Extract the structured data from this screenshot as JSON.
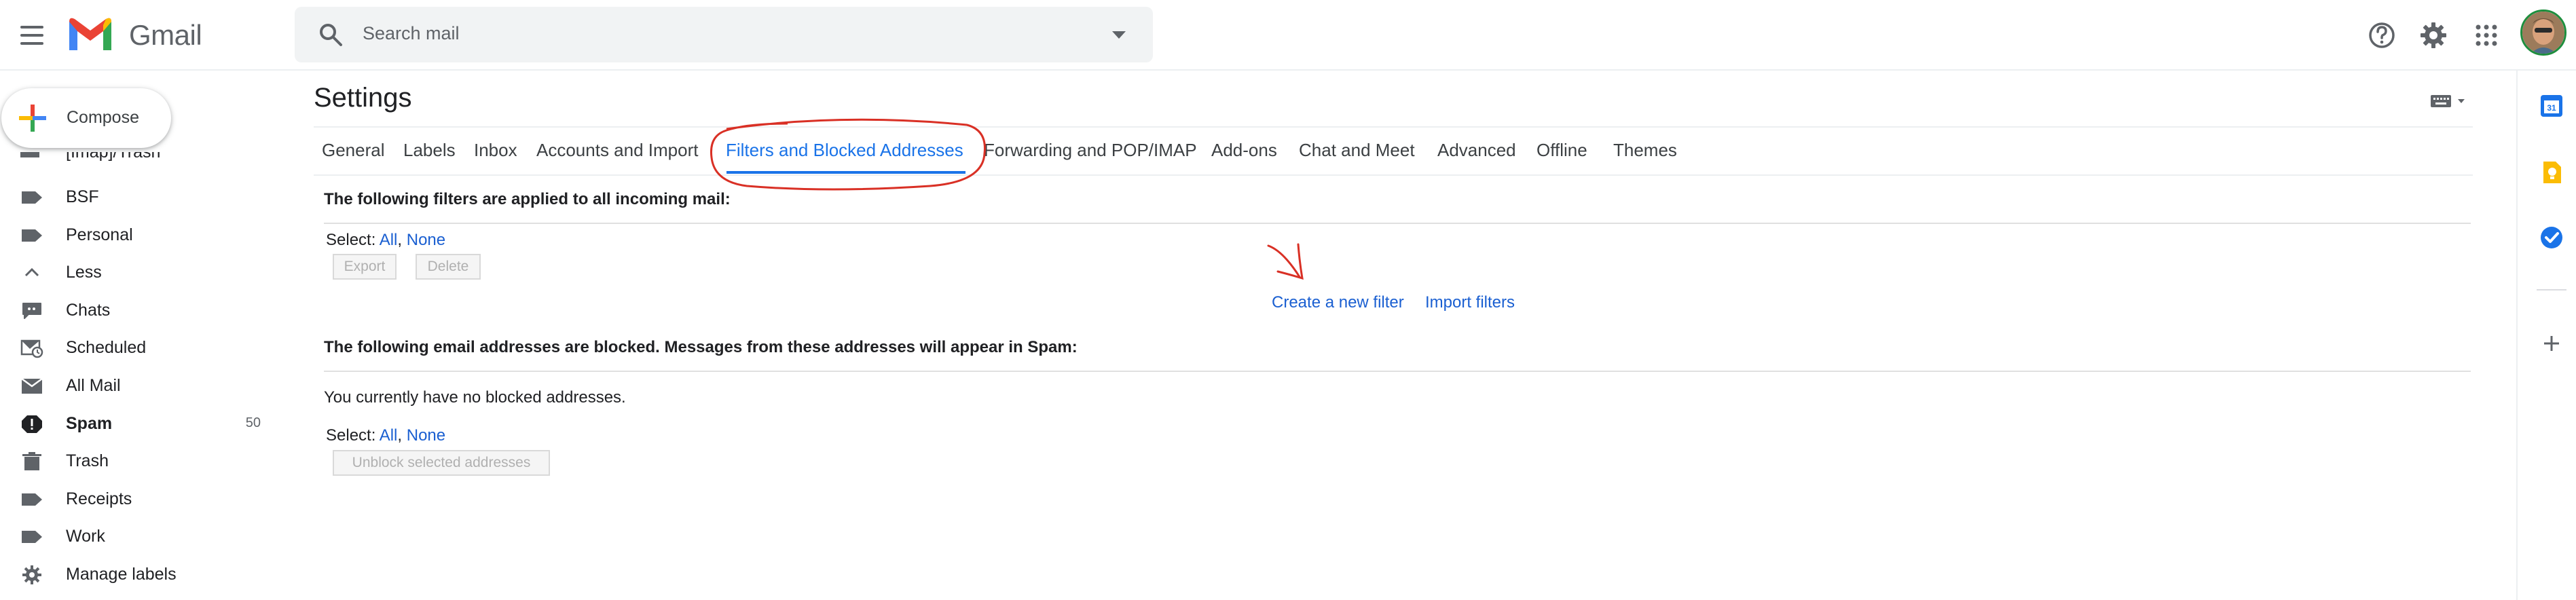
{
  "app": {
    "brand": "Gmail",
    "search_placeholder": "Search mail"
  },
  "compose": {
    "label": "Compose"
  },
  "sidebar": {
    "cut_label": "[Imap]/Trash",
    "items": [
      {
        "label": "BSF",
        "icon": "label-icon"
      },
      {
        "label": "Personal",
        "icon": "label-icon"
      },
      {
        "label": "Less",
        "icon": "chevron-up-icon"
      },
      {
        "label": "Chats",
        "icon": "chat-icon"
      },
      {
        "label": "Scheduled",
        "icon": "scheduled-icon"
      },
      {
        "label": "All Mail",
        "icon": "mail-icon"
      },
      {
        "label": "Spam",
        "icon": "spam-icon",
        "count": "50",
        "bold": true
      },
      {
        "label": "Trash",
        "icon": "trash-icon"
      },
      {
        "label": "Receipts",
        "icon": "label-icon"
      },
      {
        "label": "Work",
        "icon": "label-icon"
      },
      {
        "label": "Manage labels",
        "icon": "gear-icon"
      }
    ]
  },
  "settings": {
    "title": "Settings",
    "tabs": [
      "General",
      "Labels",
      "Inbox",
      "Accounts and Import",
      "Filters and Blocked Addresses",
      "Forwarding and POP/IMAP",
      "Add-ons",
      "Chat and Meet",
      "Advanced",
      "Offline",
      "Themes"
    ],
    "active_tab": "Filters and Blocked Addresses",
    "filters": {
      "heading": "The following filters are applied to all incoming mail:",
      "select_label": "Select:",
      "select_all": "All",
      "comma": ",",
      "select_none": "None",
      "export_label": "Export",
      "delete_label": "Delete",
      "create_filter": "Create a new filter",
      "import_filters": "Import filters"
    },
    "blocked": {
      "heading": "The following email addresses are blocked. Messages from these addresses will appear in Spam:",
      "empty_text": "You currently have no blocked addresses.",
      "select_label": "Select:",
      "select_all": "All",
      "comma": ",",
      "select_none": "None",
      "unblock_label": "Unblock selected addresses"
    }
  },
  "colors": {
    "accent": "#1a73e8",
    "link": "#1a5fd1",
    "annotation": "#d93025"
  }
}
